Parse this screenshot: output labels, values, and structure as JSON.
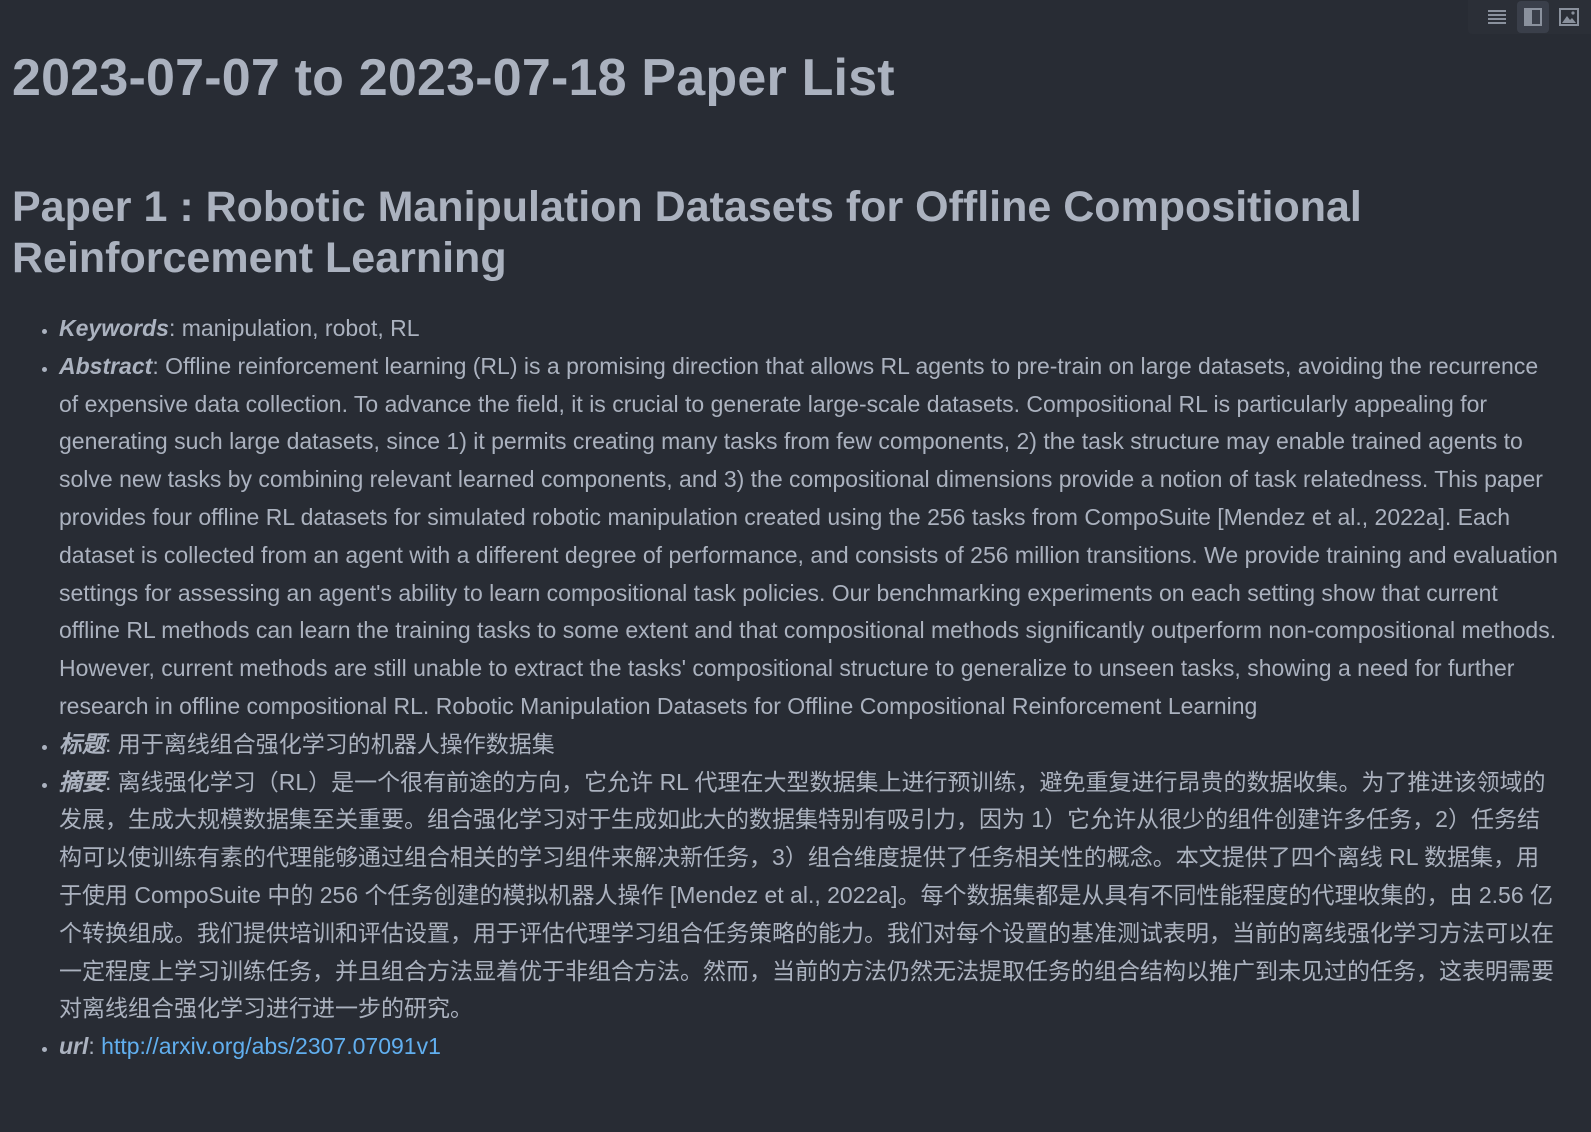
{
  "toolbar": {
    "items": [
      {
        "icon": "list-icon"
      },
      {
        "icon": "sidebar-toggle-icon"
      },
      {
        "icon": "image-icon"
      }
    ]
  },
  "page_title": "2023-07-07 to 2023-07-18 Paper List",
  "paper": {
    "heading": "Paper 1 : Robotic Manipulation Datasets for Offline Compositional Reinforcement Learning",
    "keywords_label": "Keywords",
    "keywords": ": manipulation, robot, RL",
    "abstract_label": "Abstract",
    "abstract": ": Offline reinforcement learning (RL) is a promising direction that allows RL agents to pre-train on large datasets, avoiding the recurrence of expensive data collection. To advance the field, it is crucial to generate large-scale datasets. Compositional RL is particularly appealing for generating such large datasets, since 1) it permits creating many tasks from few components, 2) the task structure may enable trained agents to solve new tasks by combining relevant learned components, and 3) the compositional dimensions provide a notion of task relatedness. This paper provides four offline RL datasets for simulated robotic manipulation created using the 256 tasks from CompoSuite [Mendez et al., 2022a]. Each dataset is collected from an agent with a different degree of performance, and consists of 256 million transitions. We provide training and evaluation settings for assessing an agent's ability to learn compositional task policies. Our benchmarking experiments on each setting show that current offline RL methods can learn the training tasks to some extent and that compositional methods significantly outperform non-compositional methods. However, current methods are still unable to extract the tasks' compositional structure to generalize to unseen tasks, showing a need for further research in offline compositional RL. Robotic Manipulation Datasets for Offline Compositional Reinforcement Learning",
    "title_cn_label": "标题",
    "title_cn": ": 用于离线组合强化学习的机器人操作数据集",
    "abstract_cn_label": "摘要",
    "abstract_cn": ": 离线强化学习（RL）是一个很有前途的方向，它允许 RL 代理在大型数据集上进行预训练，避免重复进行昂贵的数据收集。为了推进该领域的发展，生成大规模数据集至关重要。组合强化学习对于生成如此大的数据集特别有吸引力，因为 1）它允许从很少的组件创建许多任务，2）任务结构可以使训练有素的代理能够通过组合相关的学习组件来解决新任务，3）组合维度提供了任务相关性的概念。本文提供了四个离线 RL 数据集，用于使用 CompoSuite 中的 256 个任务创建的模拟机器人操作 [Mendez et al., 2022a]。每个数据集都是从具有不同性能程度的代理收集的，由 2.56 亿个转换组成。我们提供培训和评估设置，用于评估代理学习组合任务策略的能力。我们对每个设置的基准测试表明，当前的离线强化学习方法可以在一定程度上学习训练任务，并且组合方法显着优于非组合方法。然而，当前的方法仍然无法提取任务的组合结构以推广到未见过的任务，这表明需要对离线组合强化学习进行进一步的研究。",
    "url_label": "url",
    "url_sep": ": ",
    "url": "http://arxiv.org/abs/2307.07091v1"
  },
  "colors": {
    "background": "#282c34",
    "text": "#abb2bf",
    "link": "#61afef"
  }
}
